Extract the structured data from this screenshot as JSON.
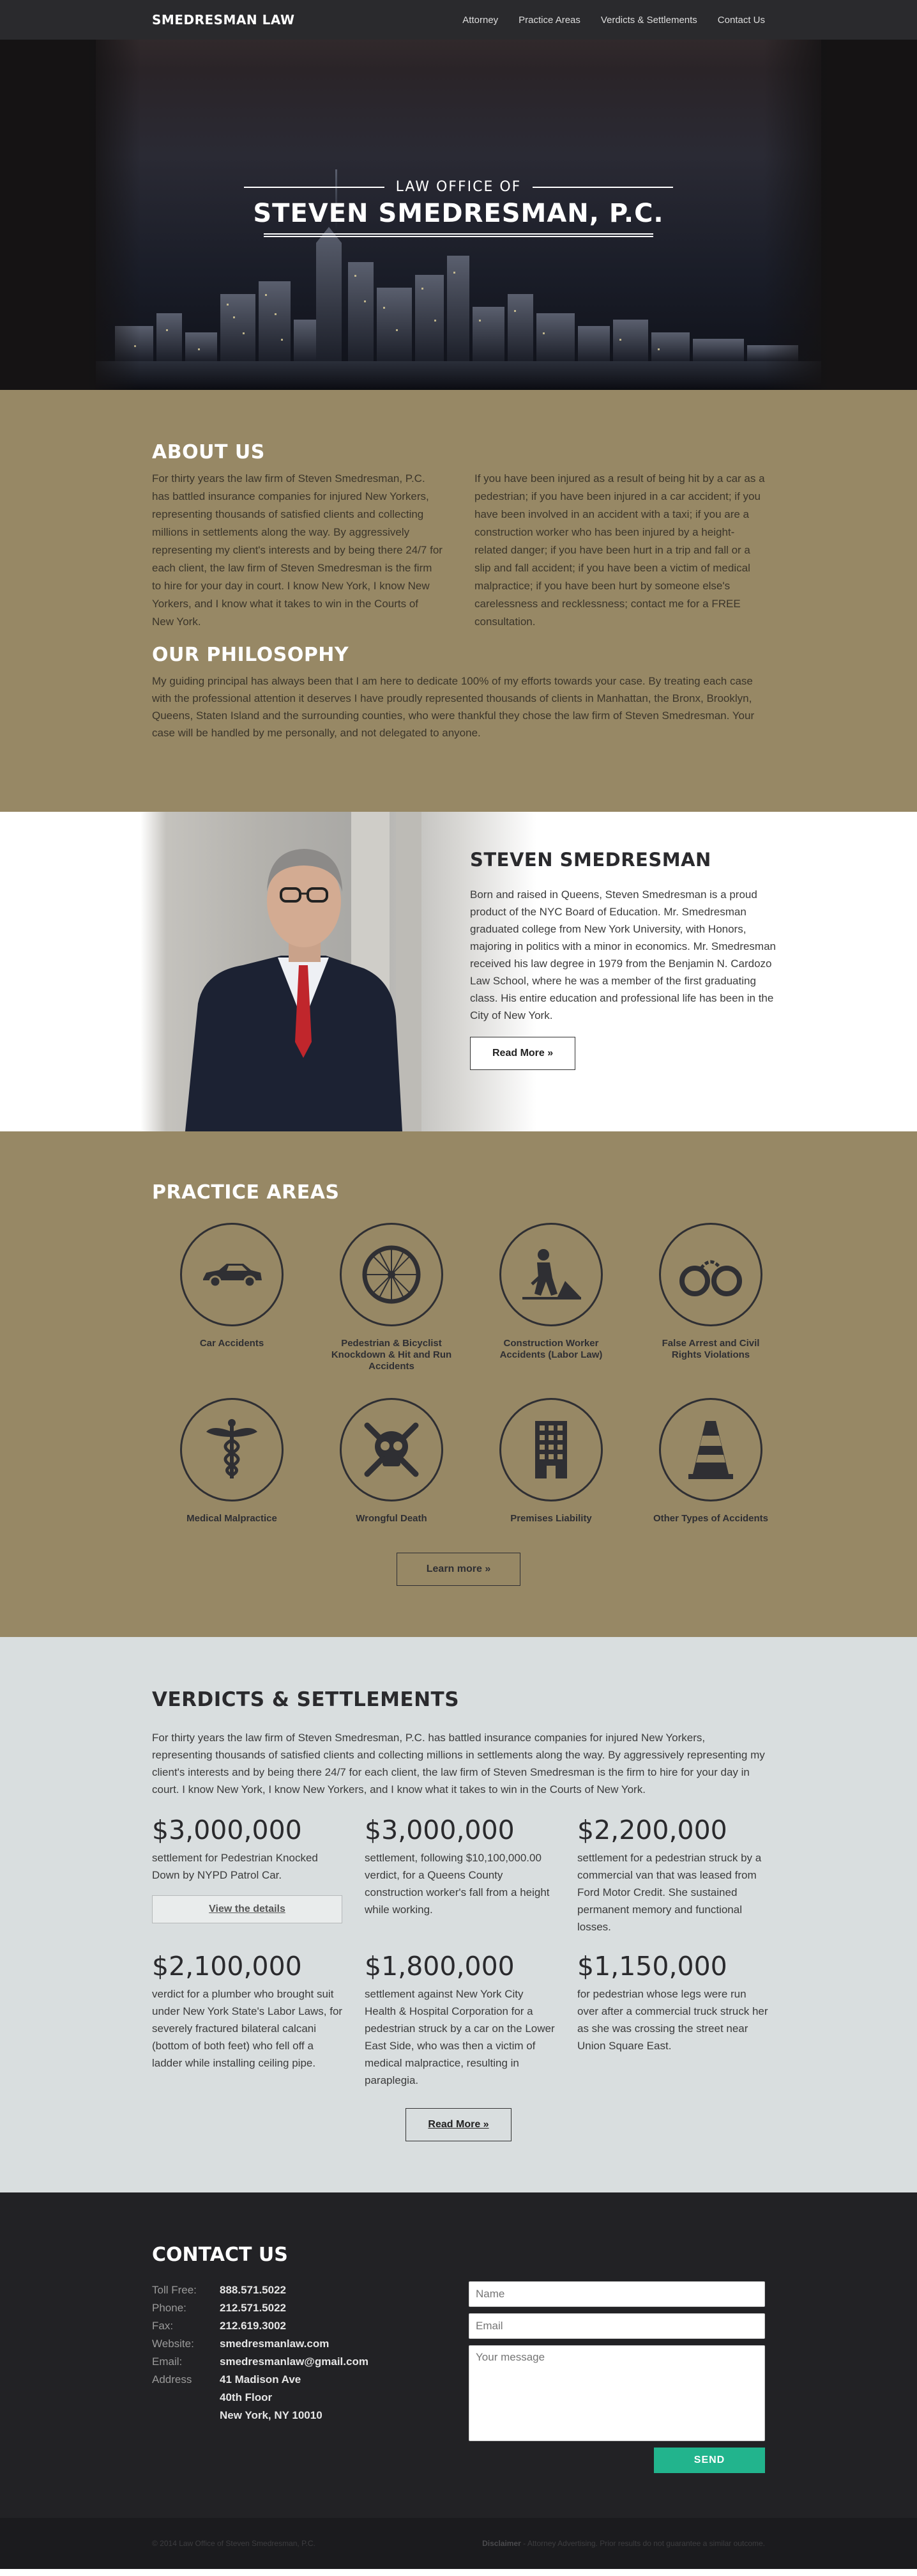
{
  "nav": {
    "brand": "SMEDRESMAN LAW",
    "items": [
      "Attorney",
      "Practice Areas",
      "Verdicts & Settlements",
      "Contact Us"
    ]
  },
  "hero": {
    "subtitle": "LAW OFFICE OF",
    "title": "STEVEN SMEDRESMAN, P.C."
  },
  "about": {
    "heading": "ABOUT US",
    "col1": "For thirty years the law firm of Steven Smedresman, P.C. has battled insurance companies for injured New Yorkers, representing thousands of satisfied clients and collecting millions in settlements along the way. By aggressively representing my client's interests and by being there 24/7 for each client, the law firm of Steven Smedresman is the firm to hire for your day in court. I know New York, I know New Yorkers, and I know what it takes to win in the Courts of New York.",
    "col2": "If you have been injured as a result of being hit by a car as a pedestrian; if you have been injured in a car accident; if you have been involved in an accident with a taxi; if you are a construction worker who has been injured by a height-related danger; if you have been hurt in a trip and fall or a slip and fall accident; if you have been a victim of medical malpractice; if you have been hurt by someone else's carelessness and recklessness; contact me for a FREE consultation.",
    "philosophy_heading": "OUR PHILOSOPHY",
    "philosophy": "My guiding principal has always been that I am here to dedicate 100% of my efforts towards your case. By treating each case with the professional attention it deserves I have proudly represented thousands of clients in Manhattan, the Bronx, Brooklyn, Queens, Staten Island and the surrounding counties, who were thankful they chose the law firm of Steven Smedresman. Your case will be handled by me personally, and not delegated to anyone."
  },
  "attorney": {
    "name": "STEVEN SMEDRESMAN",
    "bio": "Born and raised in Queens, Steven Smedresman is a proud product of the NYC Board of Education. Mr. Smedresman graduated college from New York University, with Honors, majoring in politics with a minor in economics. Mr. Smedresman received his law degree in 1979 from the Benjamin N. Cardozo Law School, where he was a member of the first graduating class. His entire education and professional life has been in the City of New York.",
    "button": "Read More »"
  },
  "practice": {
    "heading": "PRACTICE AREAS",
    "areas": [
      {
        "label": "Car Accidents",
        "icon": "car-icon"
      },
      {
        "label": "Pedestrian & Bicyclist Knockdown & Hit and Run Accidents",
        "icon": "bicycle-wheel-icon"
      },
      {
        "label": "Construction Worker Accidents (Labor Law)",
        "icon": "construction-worker-icon"
      },
      {
        "label": "False Arrest and Civil Rights Violations",
        "icon": "handcuffs-icon"
      },
      {
        "label": "Medical Malpractice",
        "icon": "caduceus-icon"
      },
      {
        "label": "Wrongful Death",
        "icon": "skull-crossbones-icon"
      },
      {
        "label": "Premises Liability",
        "icon": "building-icon"
      },
      {
        "label": "Other Types of Accidents",
        "icon": "traffic-cone-icon"
      }
    ],
    "button": "Learn more »"
  },
  "verdicts": {
    "heading": "VERDICTS & SETTLEMENTS",
    "intro": "For thirty years the law firm of Steven Smedresman, P.C. has battled insurance companies for injured New Yorkers, representing thousands of satisfied clients and collecting millions in settlements along the way. By aggressively representing my client's interests and by being there 24/7 for each client, the law firm of Steven Smedresman is the firm to hire for your day in court. I know New York, I know New Yorkers, and I know what it takes to win in the Courts of New York.",
    "items": [
      {
        "amount": "$3,000,000",
        "desc": "settlement for Pedestrian Knocked Down by NYPD Patrol Car."
      },
      {
        "amount": "$3,000,000",
        "desc": "settlement, following $10,100,000.00 verdict, for a Queens County construction worker's fall from a height while working."
      },
      {
        "amount": "$2,200,000",
        "desc": "settlement for a pedestrian struck by a commercial van that was leased from Ford Motor Credit. She sustained permanent memory and functional losses."
      },
      {
        "amount": "$2,100,000",
        "desc": "verdict for a plumber who brought suit under New York State's Labor Laws, for severely fractured bilateral calcani (bottom of both feet) who fell off a ladder while installing ceiling pipe."
      },
      {
        "amount": "$1,800,000",
        "desc": "settlement against New York City Health & Hospital Corporation for a pedestrian struck by a car on the Lower East Side, who was then a victim of medical malpractice, resulting in paraplegia."
      },
      {
        "amount": "$1,150,000",
        "desc": "for pedestrian whose legs were run over after a commercial truck struck her as she was crossing the street near Union Square East."
      }
    ],
    "details_button": "View the details",
    "button": "Read More »"
  },
  "contact": {
    "heading": "CONTACT US",
    "rows": [
      {
        "label": "Toll Free:",
        "value": "888.571.5022"
      },
      {
        "label": "Phone:",
        "value": "212.571.5022"
      },
      {
        "label": "Fax:",
        "value": "212.619.3002"
      },
      {
        "label": "Website:",
        "value": "smedresmanlaw.com"
      },
      {
        "label": "Email:",
        "value": "smedresmanlaw@gmail.com"
      },
      {
        "label": "Address",
        "value": "41 Madison Ave"
      },
      {
        "label": "",
        "value": "40th Floor"
      },
      {
        "label": "",
        "value": "New York, NY 10010"
      }
    ],
    "form": {
      "name_placeholder": "Name",
      "email_placeholder": "Email",
      "message_placeholder": "Your message",
      "send": "SEND"
    }
  },
  "footer": {
    "copyright": "© 2014 Law Office of Steven Smedresman, P.C.",
    "disclaimer_label": "Disclaimer",
    "disclaimer_text": " - Attorney Advertising. Prior results do not guarantee a similar outcome."
  }
}
